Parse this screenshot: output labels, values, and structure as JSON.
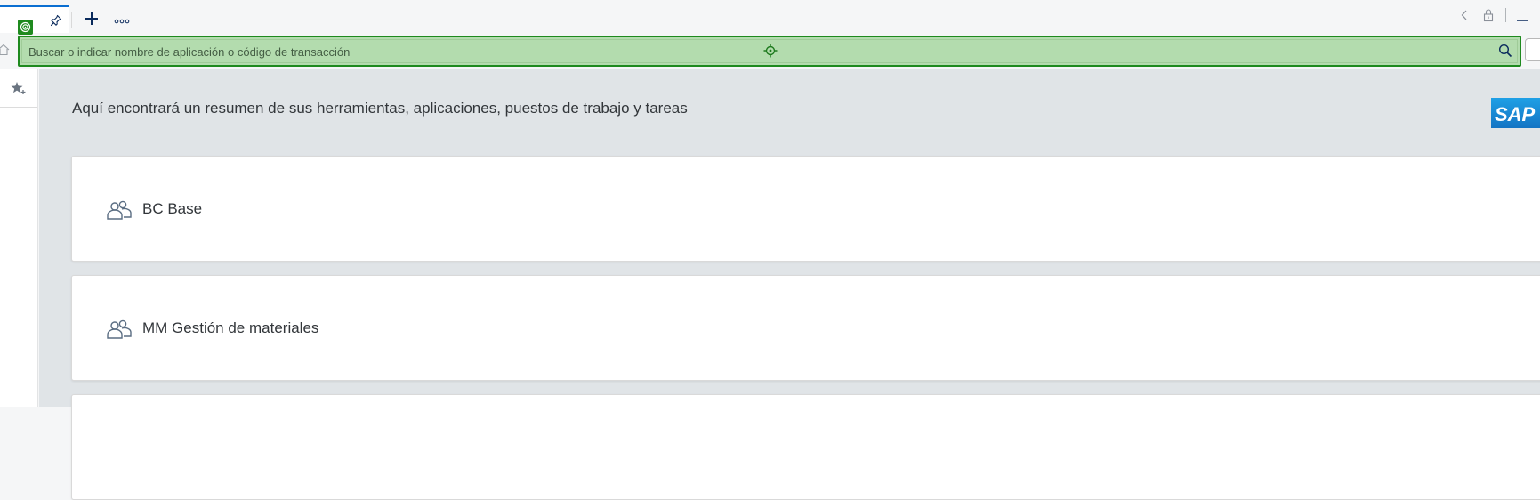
{
  "search": {
    "placeholder": "Buscar o indicar nombre de aplicación o código de transacción"
  },
  "icons": {
    "app_badge": "target-icon",
    "pin": "pin-icon",
    "new_tab": "plus-icon",
    "more": "more-dots-icon",
    "back": "chevron-left-icon",
    "lock": "lock-icon",
    "minimize": "minimize-icon",
    "home": "home-icon",
    "search": "search-icon",
    "favorites": "star-add-icon",
    "role": "group-icon"
  },
  "colors": {
    "accent": "#0a6ed1",
    "highlight_green": "#1e8a1e",
    "highlight_fill": "#b3dcae",
    "content_bg": "#e0e4e7",
    "sap_blue": "#1a8fd8"
  },
  "main": {
    "description": "Aquí encontrará un resumen de sus herramientas, aplicaciones, puestos de trabajo y tareas",
    "logo_text": "SAP",
    "cards": [
      {
        "title": "BC Base"
      },
      {
        "title": "MM Gestión de materiales"
      }
    ]
  }
}
